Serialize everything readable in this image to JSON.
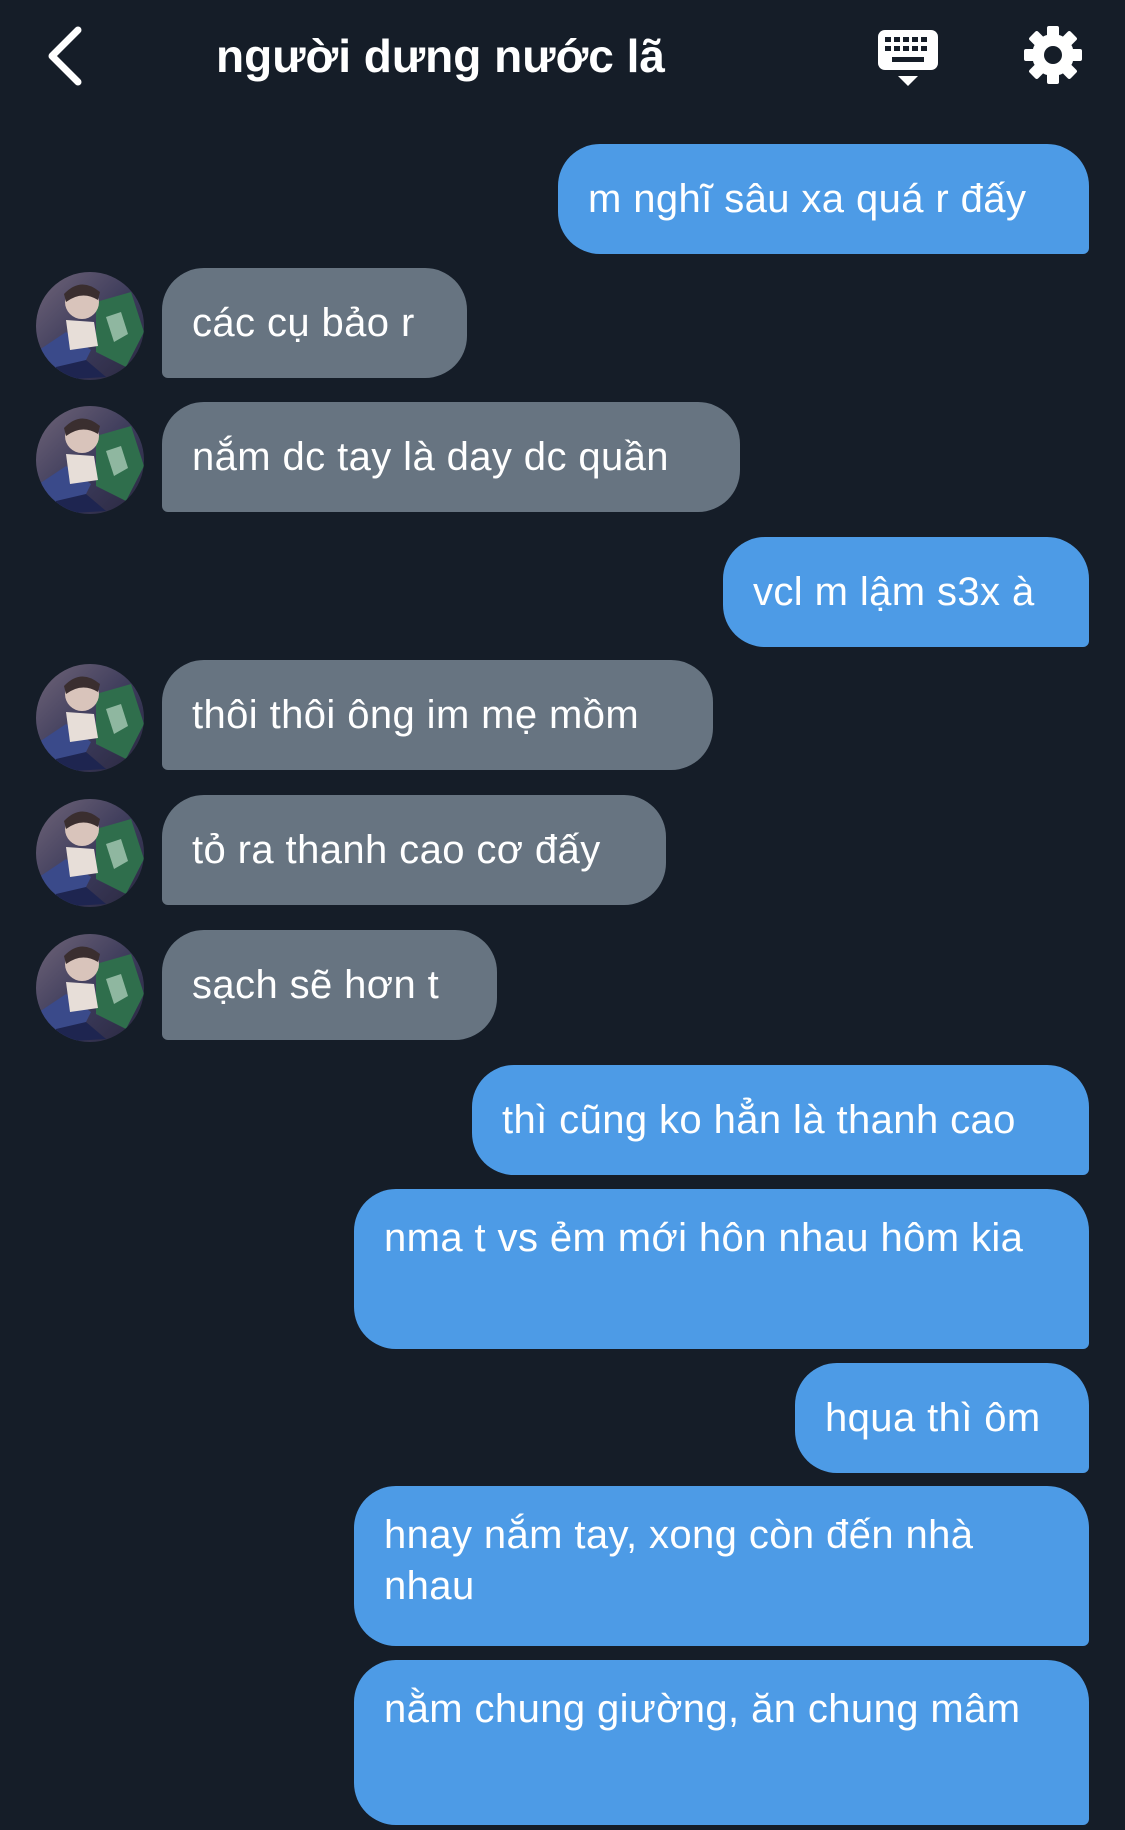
{
  "header": {
    "title": "người dưng nước lã",
    "back_icon": "chevron-left-icon",
    "keyboard_icon": "keyboard-icon",
    "settings_icon": "gear-icon"
  },
  "colors": {
    "background": "#151d28",
    "outgoing_bubble": "#4d9be6",
    "incoming_bubble": "#677481"
  },
  "messages": [
    {
      "direction": "outgoing",
      "text": "m nghĩ sâu xa quá r đấy"
    },
    {
      "direction": "incoming",
      "text": "các cụ bảo r"
    },
    {
      "direction": "incoming",
      "text": "nắm dc tay là day dc quần"
    },
    {
      "direction": "outgoing",
      "text": "vcl m lậm s3x à"
    },
    {
      "direction": "incoming",
      "text": "thôi thôi ông im mẹ mồm"
    },
    {
      "direction": "incoming",
      "text": "tỏ ra thanh cao cơ đấy"
    },
    {
      "direction": "incoming",
      "text": "sạch sẽ hơn t"
    },
    {
      "direction": "outgoing",
      "text": "thì cũng ko hẳn là thanh cao"
    },
    {
      "direction": "outgoing",
      "text": "nma t vs ẻm mới hôn nhau hôm kia"
    },
    {
      "direction": "outgoing",
      "text": "hqua thì ôm"
    },
    {
      "direction": "outgoing",
      "text": "hnay nắm tay, xong còn đến nhà nhau"
    },
    {
      "direction": "outgoing",
      "text": "nằm chung giường, ăn chung mâm"
    }
  ]
}
